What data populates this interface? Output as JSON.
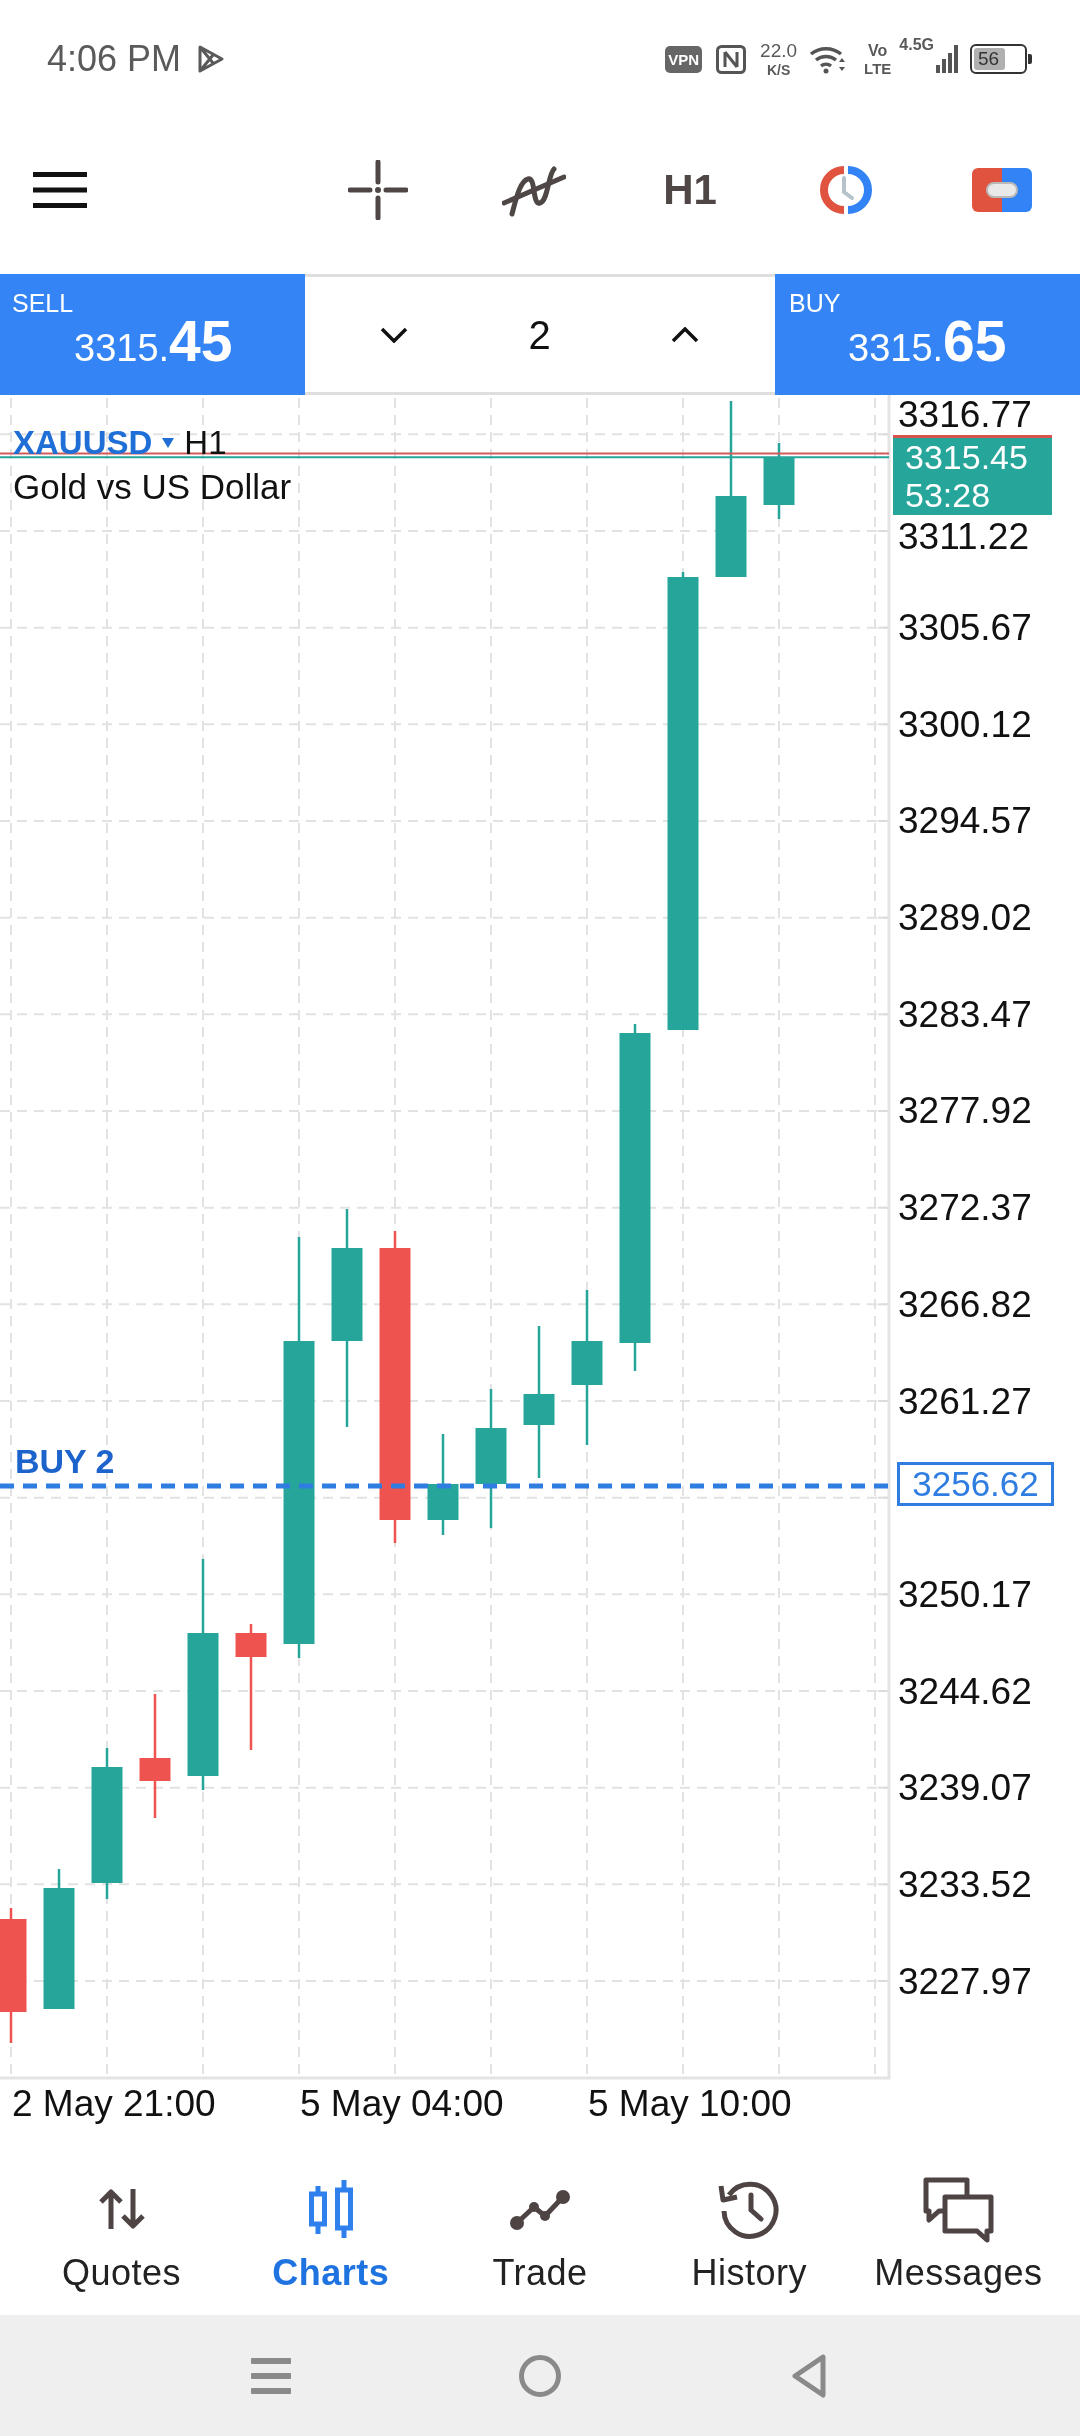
{
  "status_bar": {
    "time": "4:06 PM",
    "vpn": "VPN",
    "speed": "22.0",
    "speed_unit": "K/S",
    "volte": [
      "Vo",
      "LTE"
    ],
    "network": "4.5G",
    "battery": "56"
  },
  "toolbar": {
    "timeframe": "H1"
  },
  "trade_panel": {
    "sell": {
      "label": "SELL",
      "price": "3315.**45**"
    },
    "volume": "2",
    "buy": {
      "label": "BUY",
      "price": "3315.**65**"
    }
  },
  "chart": {
    "symbol": "XAUUSD",
    "timeframe": "H1",
    "description": "Gold vs US Dollar",
    "price_axis": [
      "3316.77",
      "3311.22",
      "3305.67",
      "3300.12",
      "3294.57",
      "3289.02",
      "3283.47",
      "3277.92",
      "3272.37",
      "3266.82",
      "3261.27",
      "3250.17",
      "3244.62",
      "3239.07",
      "3233.52",
      "3227.97"
    ],
    "current_price": {
      "price": "3315.45",
      "countdown": "53:28"
    },
    "order": {
      "label": "BUY 2",
      "price": "3256.62"
    },
    "time_axis": [
      "2 May 21:00",
      "5 May 04:00",
      "5 May 10:00"
    ]
  },
  "bottom_nav": [
    {
      "label": "Quotes",
      "selected": false
    },
    {
      "label": "Charts",
      "selected": true
    },
    {
      "label": "Trade",
      "selected": false
    },
    {
      "label": "History",
      "selected": false
    },
    {
      "label": "Messages",
      "selected": false
    }
  ]
}
